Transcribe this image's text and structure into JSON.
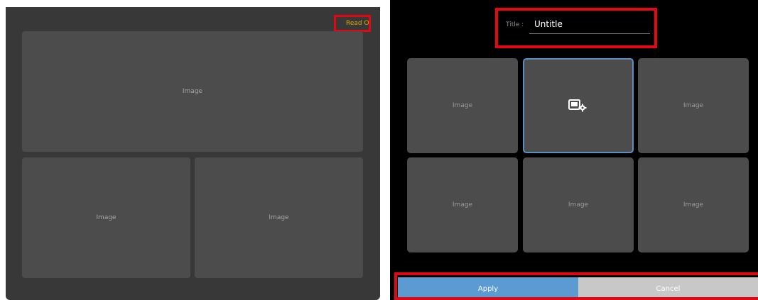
{
  "left_panel": {
    "readonly_badge": "Read Only",
    "tiles": [
      {
        "label": "Image"
      },
      {
        "label": "Image"
      },
      {
        "label": "Image"
      }
    ]
  },
  "right_panel": {
    "title_label": "Title :",
    "title_value": "Untitle",
    "grid": [
      {
        "label": "Image"
      },
      {
        "label": "",
        "icon": "image-settings-icon",
        "selected": true
      },
      {
        "label": "Image"
      },
      {
        "label": "Image"
      },
      {
        "label": "Image"
      },
      {
        "label": "Image"
      }
    ],
    "apply_label": "Apply",
    "cancel_label": "Cancel"
  },
  "colors": {
    "highlight": "#e30613",
    "readonly_text": "#e0a800",
    "apply": "#5b9bd1",
    "cancel": "#c8c8c8",
    "selected_border": "#5a8fc0"
  }
}
